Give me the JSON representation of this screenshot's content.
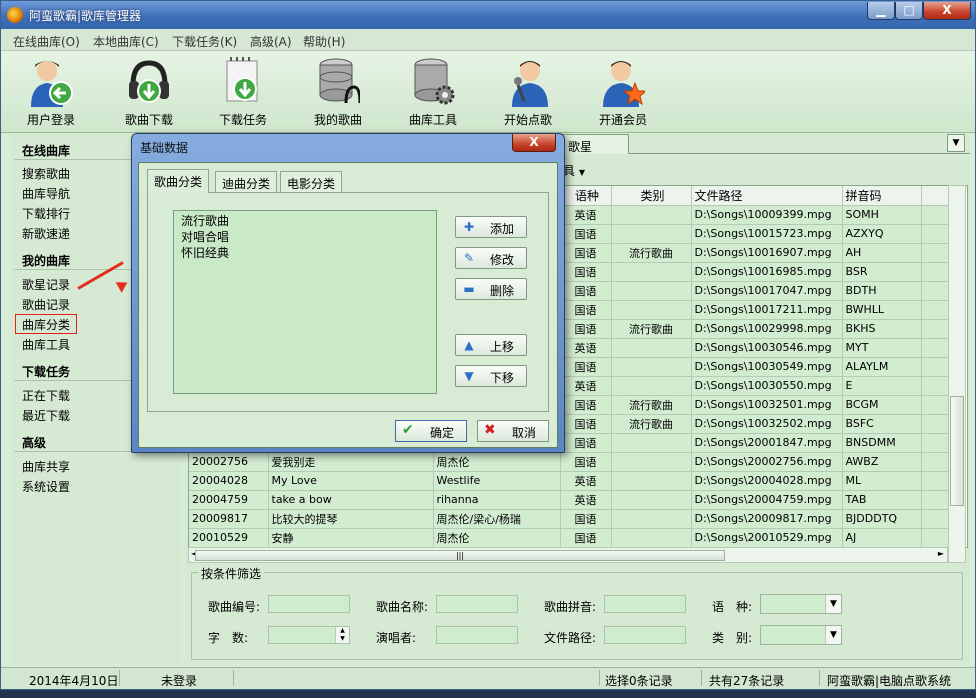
{
  "window": {
    "title": "阿蛮歌霸|歌库管理器",
    "min": "▁",
    "max": "□",
    "close": "X"
  },
  "menu": [
    "在线曲库(O)",
    "本地曲库(C)",
    "下载任务(K)",
    "高级(A)",
    "帮助(H)"
  ],
  "toolbar": [
    {
      "label": "用户登录",
      "icon": "user-login-icon"
    },
    {
      "label": "歌曲下载",
      "icon": "headphones-download-icon"
    },
    {
      "label": "下载任务",
      "icon": "download-task-icon"
    },
    {
      "label": "我的歌曲",
      "icon": "database-music-icon"
    },
    {
      "label": "曲库工具",
      "icon": "database-gear-icon"
    },
    {
      "label": "开始点歌",
      "icon": "singer-mic-icon"
    },
    {
      "label": "开通会员",
      "icon": "vip-star-icon"
    }
  ],
  "sidebar": {
    "online": {
      "title": "在线曲库",
      "items": [
        "搜索歌曲",
        "曲库导航",
        "下载排行",
        "新歌速递"
      ]
    },
    "mylib": {
      "title": "我的曲库",
      "items": [
        "歌星记录",
        "歌曲记录",
        "曲库分类",
        "曲库工具"
      ]
    },
    "tasks": {
      "title": "下载任务",
      "items": [
        "正在下载",
        "最近下载"
      ]
    },
    "advanced": {
      "title": "高级",
      "items": [
        "曲库共享",
        "系统设置"
      ]
    }
  },
  "tabs": {
    "singer_tab": "歌星",
    "toolbar_label": "具"
  },
  "grid": {
    "columns": [
      "",
      "",
      "",
      "语种",
      "类别",
      "文件路径",
      "拼音码"
    ],
    "rows": [
      [
        "",
        "",
        "",
        "英语",
        "",
        "D:\\Songs\\10009399.mpg",
        "SOMH"
      ],
      [
        "",
        "",
        "",
        "国语",
        "",
        "D:\\Songs\\10015723.mpg",
        "AZXYQ"
      ],
      [
        "",
        "",
        "",
        "国语",
        "流行歌曲",
        "D:\\Songs\\10016907.mpg",
        "AH"
      ],
      [
        "",
        "",
        "",
        "国语",
        "",
        "D:\\Songs\\10016985.mpg",
        "BSR"
      ],
      [
        "",
        "",
        "",
        "国语",
        "",
        "D:\\Songs\\10017047.mpg",
        "BDTH"
      ],
      [
        "",
        "",
        "",
        "国语",
        "",
        "D:\\Songs\\10017211.mpg",
        "BWHLL"
      ],
      [
        "",
        "",
        "",
        "国语",
        "流行歌曲",
        "D:\\Songs\\10029998.mpg",
        "BKHS"
      ],
      [
        "",
        "",
        "",
        "英语",
        "",
        "D:\\Songs\\10030546.mpg",
        "MYT"
      ],
      [
        "",
        "",
        "",
        "国语",
        "",
        "D:\\Songs\\10030549.mpg",
        "ALAYLM"
      ],
      [
        "",
        "",
        "",
        "英语",
        "",
        "D:\\Songs\\10030550.mpg",
        "E"
      ],
      [
        "",
        "",
        "",
        "国语",
        "流行歌曲",
        "D:\\Songs\\10032501.mpg",
        "BCGM"
      ],
      [
        "",
        "",
        "",
        "国语",
        "流行歌曲",
        "D:\\Songs\\10032502.mpg",
        "BSFC"
      ],
      [
        "",
        "",
        "",
        "国语",
        "",
        "D:\\Songs\\20001847.mpg",
        "BNSDMM"
      ],
      [
        "20002756",
        "爱我别走",
        "周杰伦",
        "国语",
        "",
        "D:\\Songs\\20002756.mpg",
        "AWBZ"
      ],
      [
        "20004028",
        "My Love",
        "Westlife",
        "英语",
        "",
        "D:\\Songs\\20004028.mpg",
        "ML"
      ],
      [
        "20004759",
        "take a bow",
        "rihanna",
        "英语",
        "",
        "D:\\Songs\\20004759.mpg",
        "TAB"
      ],
      [
        "20009817",
        "比较大的提琴",
        "周杰伦/梁心/杨瑞",
        "国语",
        "",
        "D:\\Songs\\20009817.mpg",
        "BJDDDTQ"
      ],
      [
        "20010529",
        "安静",
        "周杰伦",
        "国语",
        "",
        "D:\\Songs\\20010529.mpg",
        "AJ"
      ]
    ]
  },
  "filter": {
    "legend": "按条件筛选",
    "song_no": "歌曲编号:",
    "song_name": "歌曲名称:",
    "song_pinyin": "歌曲拼音:",
    "language": "语　种:",
    "word_count": "字　数:",
    "singer": "演唱者:",
    "file_path": "文件路径:",
    "category": "类　别:"
  },
  "status": {
    "date": "2014年4月10日",
    "login": "未登录",
    "selected": "选择0条记录",
    "total": "共有27条记录",
    "brand": "阿蛮歌霸|电脑点歌系统"
  },
  "dialog": {
    "title": "基础数据",
    "close": "X",
    "tabs": [
      "歌曲分类",
      "迪曲分类",
      "电影分类"
    ],
    "list": [
      "流行歌曲",
      "对唱合唱",
      "怀旧经典"
    ],
    "add": "添加",
    "edit": "修改",
    "delete": "删除",
    "up": "上移",
    "down": "下移",
    "ok": "确定",
    "cancel": "取消"
  },
  "colors": {
    "accent": "#3f6fb8",
    "panel": "#d6ead3",
    "grid_row": "#d2ecd0",
    "highlight": "#e02020"
  }
}
